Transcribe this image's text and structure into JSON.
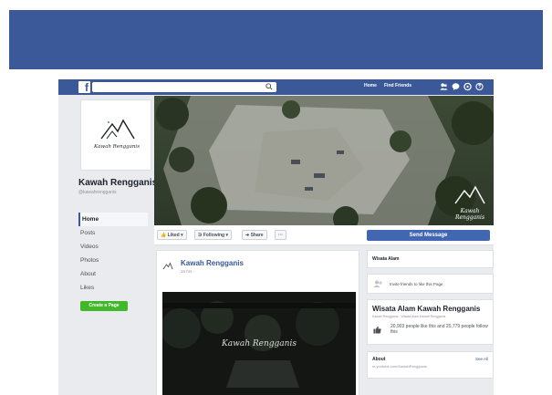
{
  "colors": {
    "brand": "#3b5998",
    "button": "#4267b2",
    "create": "#42b72a",
    "link": "#365899",
    "background": "#e9ebee"
  },
  "topbar": {
    "logo": "f",
    "search_placeholder": "",
    "home": "Home",
    "find_friends": "Find Friends",
    "icons": [
      "friends-icon",
      "messages-icon",
      "notifications-icon",
      "help-icon"
    ],
    "account_caret": "▾"
  },
  "profile": {
    "brand_text": "Kawah Rengganis",
    "name": "Kawah Rengganis",
    "handle": "@kawahrengganis"
  },
  "left_nav": [
    {
      "label": "Home",
      "active": true
    },
    {
      "label": "Posts"
    },
    {
      "label": "Videos"
    },
    {
      "label": "Photos"
    },
    {
      "label": "About"
    },
    {
      "label": "Likes"
    }
  ],
  "create_page": "Create a Page",
  "cover": {
    "watermark": "Kawah Rengganis"
  },
  "actions": {
    "liked": "Liked ▾",
    "following": "Following ▾",
    "share": "Share",
    "more": "···",
    "send_message": "Send Message"
  },
  "post": {
    "name": "Kawah Rengganis",
    "meta": "16 hrs · ",
    "video_title": "Kawah Rengganis"
  },
  "right": {
    "category": "Wisata Alam",
    "invite": "Invite friends to like this Page",
    "big_title": "Wisata Alam Kawah Rengganis",
    "big_sub": "Kawah Rengganis · Wisata Alam Kawah Rengganis",
    "likes": "20,903 people like this and 20,779 people follow this",
    "about": "About",
    "see_all": "See All",
    "about_link": "m.youtube.com/KawahRengganis"
  }
}
